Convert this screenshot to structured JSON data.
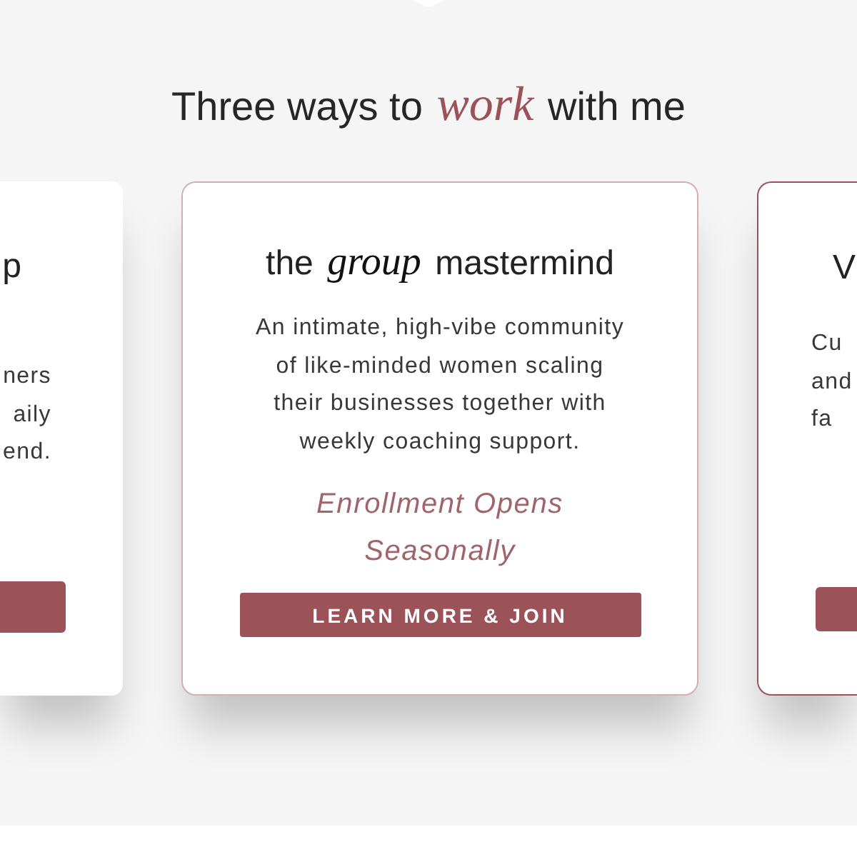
{
  "page": {
    "heading": "Three ways to *work* with me"
  },
  "cards": [
    {
      "kind": "plain",
      "title": "p",
      "description": "ners\naily\nend.",
      "button": {
        "visible": true
      }
    },
    {
      "kind": "outlined",
      "title": "the *group* mastermind",
      "description": "An intimate, high-vibe community\nof like-minded women scaling\ntheir businesses together with\nweekly coaching support.",
      "note": "Enrollment Opens\nSeasonally",
      "button": {
        "visible": true,
        "label": "LEARN MORE & JOIN"
      }
    },
    {
      "kind": "accent",
      "title": "V",
      "description": "Cu\nand\nfa",
      "button": {
        "visible": true
      }
    }
  ]
}
